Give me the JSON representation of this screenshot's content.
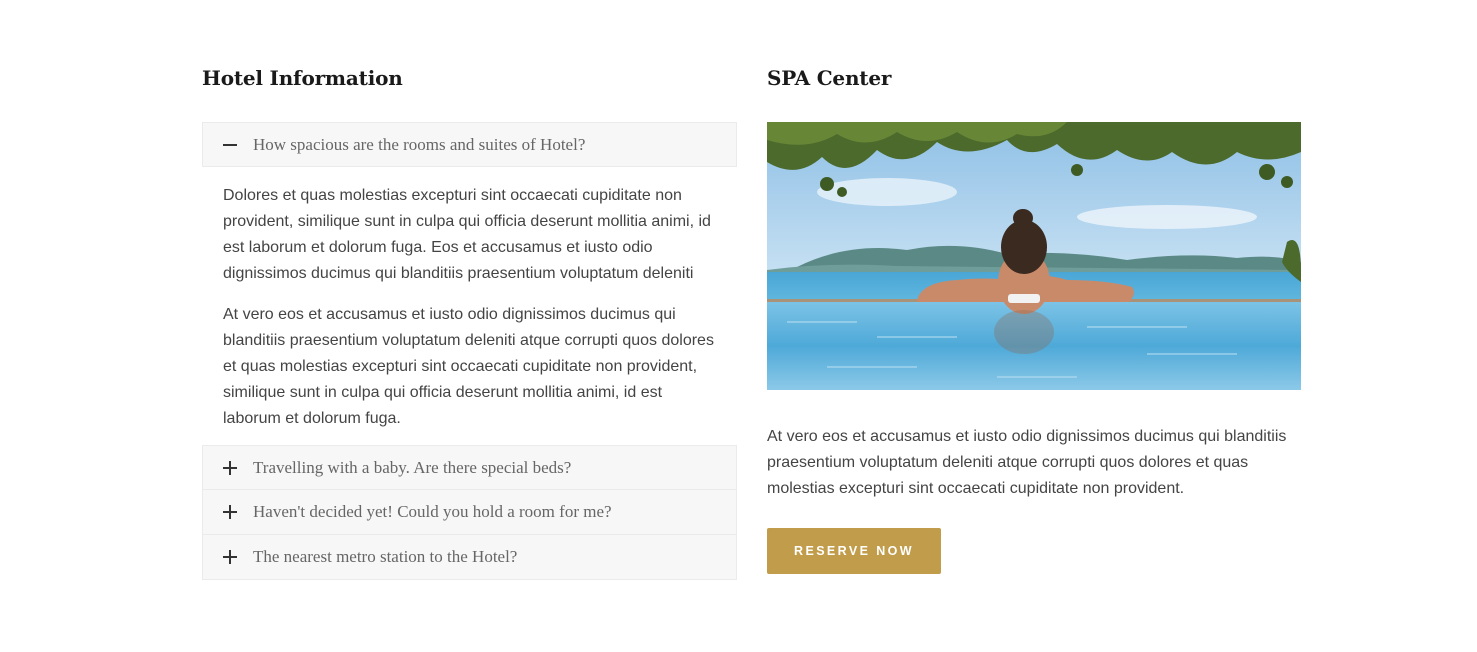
{
  "hotel_info": {
    "title": "Hotel Information",
    "items": [
      {
        "question": "How spacious are the rooms and suites of Hotel?",
        "state": "open",
        "icon": "minus-icon",
        "paragraphs": [
          "Dolores et quas molestias excepturi sint occaecati cupiditate non provident, similique sunt in culpa qui officia deserunt mollitia animi, id est laborum et dolorum fuga. Eos et accusamus et iusto odio dignissimos ducimus qui blanditiis praesentium voluptatum deleniti",
          "At vero eos et accusamus et iusto odio dignissimos ducimus qui blanditiis praesentium voluptatum deleniti atque corrupti quos dolores et quas molestias excepturi sint occaecati cupiditate non provident, similique sunt in culpa qui officia deserunt mollitia animi, id est laborum et dolorum fuga."
        ]
      },
      {
        "question": "Travelling with a baby. Are there special beds?",
        "state": "closed",
        "icon": "plus-icon"
      },
      {
        "question": "Haven't decided yet! Could you hold a room for me?",
        "state": "closed",
        "icon": "plus-icon"
      },
      {
        "question": "The nearest metro station to the Hotel?",
        "state": "closed",
        "icon": "plus-icon"
      }
    ]
  },
  "spa": {
    "title": "SPA Center",
    "image_description_icon": "pool-photo",
    "text": "At vero eos et accusamus et iusto odio dignissimos ducimus qui blanditiis praesentium voluptatum deleniti atque corrupti quos dolores et quas molestias excepturi sint occaecati cupiditate non provident.",
    "button_label": "RESERVE NOW"
  },
  "colors": {
    "accent": "#c19c4a",
    "heading": "#1a1a1a",
    "body_text": "#444444",
    "accordion_bg": "#f7f7f7"
  }
}
